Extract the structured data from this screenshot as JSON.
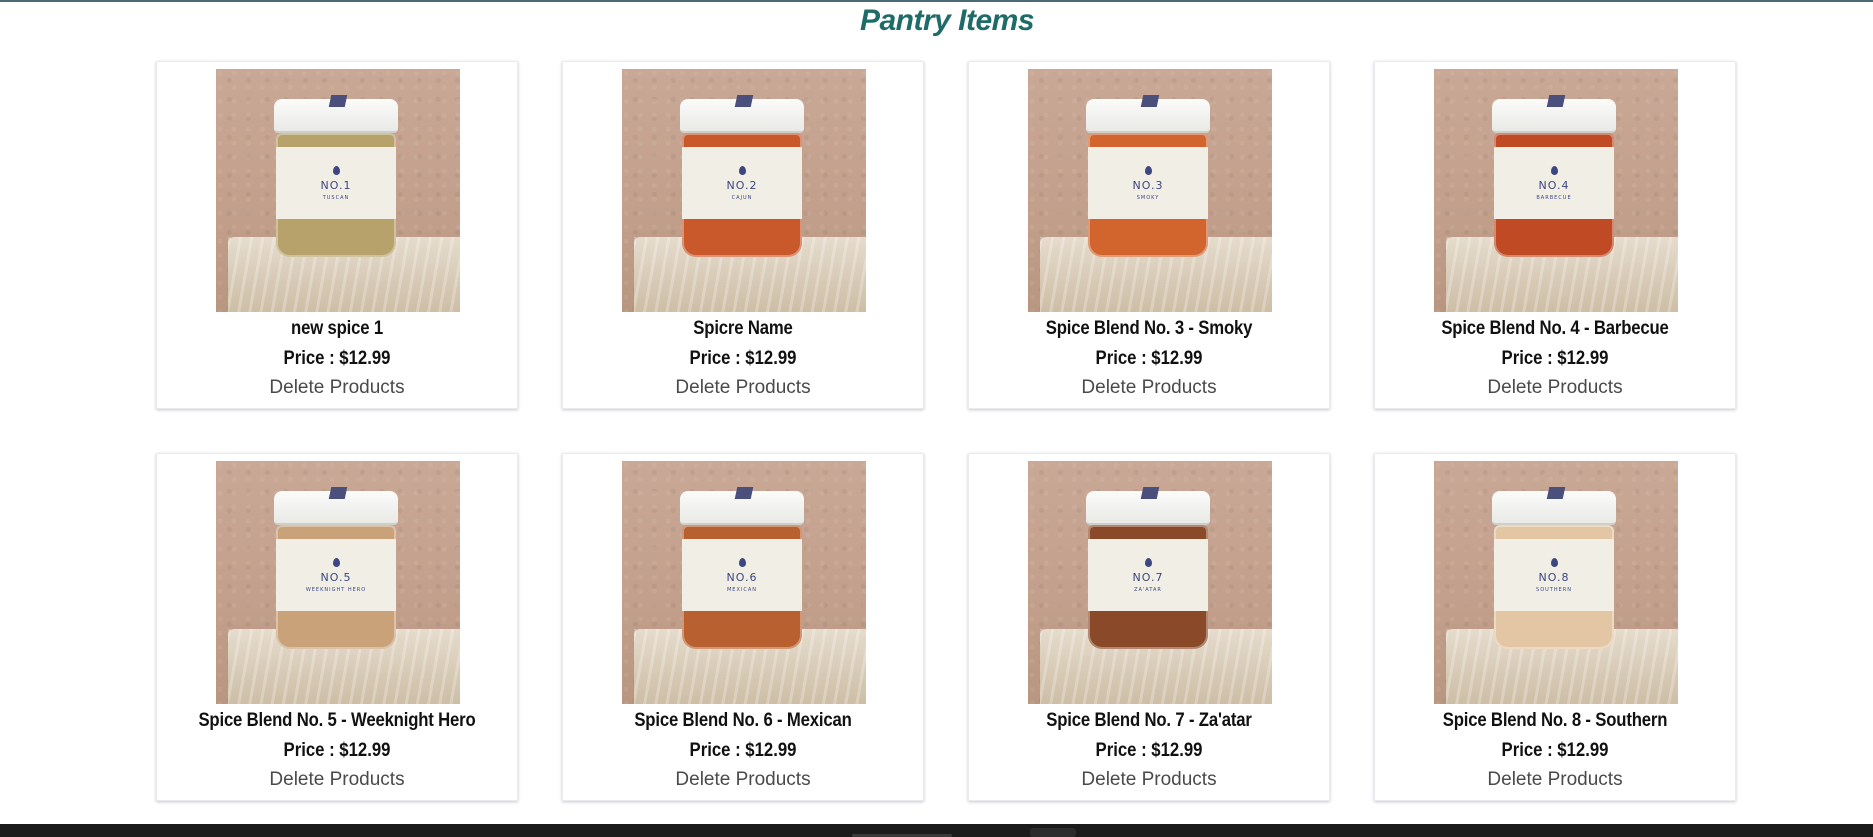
{
  "page": {
    "title": "Pantry Items"
  },
  "colors": {
    "title": "#1f6b68",
    "footer": "#1b1b1b",
    "top_rule": "#4a6a78"
  },
  "products": [
    {
      "name": "new spice 1",
      "price": "Price : $12.99",
      "action": "Delete Products",
      "jar_label": "NO.1",
      "jar_sub": "TUSCAN",
      "spice_color": "#b6a26a"
    },
    {
      "name": "Spicre Name",
      "price": "Price : $12.99",
      "action": "Delete Products",
      "jar_label": "NO.2",
      "jar_sub": "CAJUN",
      "spice_color": "#c9582b"
    },
    {
      "name": "Spice Blend No. 3 - Smoky",
      "price": "Price : $12.99",
      "action": "Delete Products",
      "jar_label": "NO.3",
      "jar_sub": "SMOKY",
      "spice_color": "#d2642e"
    },
    {
      "name": "Spice Blend No. 4 - Barbecue",
      "price": "Price : $12.99",
      "action": "Delete Products",
      "jar_label": "NO.4",
      "jar_sub": "BARBECUE",
      "spice_color": "#bf4a24"
    },
    {
      "name": "Spice Blend No. 5 - Weeknight Hero",
      "price": "Price : $12.99",
      "action": "Delete Products",
      "jar_label": "NO.5",
      "jar_sub": "WEEKNIGHT HERO",
      "spice_color": "#c9a27a"
    },
    {
      "name": "Spice Blend No. 6 - Mexican",
      "price": "Price : $12.99",
      "action": "Delete Products",
      "jar_label": "NO.6",
      "jar_sub": "MEXICAN",
      "spice_color": "#b8602f"
    },
    {
      "name": "Spice Blend No. 7 - Za'atar",
      "price": "Price : $12.99",
      "action": "Delete Products",
      "jar_label": "NO.7",
      "jar_sub": "ZA'ATAR",
      "spice_color": "#8a4a2a"
    },
    {
      "name": "Spice Blend No. 8 - Southern",
      "price": "Price : $12.99",
      "action": "Delete Products",
      "jar_label": "NO.8",
      "jar_sub": "SOUTHERN",
      "spice_color": "#e3c7a4"
    }
  ]
}
